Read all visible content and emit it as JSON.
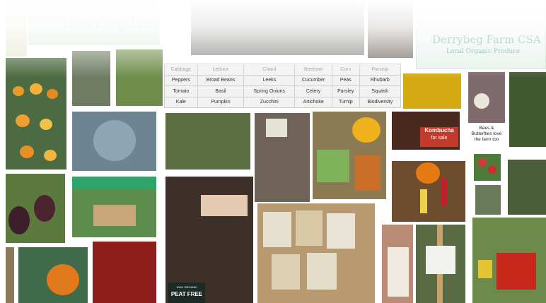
{
  "header_sign": {
    "left_text": "Derrybeg Farm",
    "right_title": "Derrybeg Farm CSA",
    "right_subtitle": "Local Organic Produce"
  },
  "vegetable_table": {
    "rows": [
      [
        "Cabbage",
        "Lettuce",
        "Chard",
        "Beetroot",
        "Corn",
        "Parsnip"
      ],
      [
        "Peppers",
        "Broad Beans",
        "Leeks",
        "Cucumber",
        "Peas",
        "Rhubarb"
      ],
      [
        "Tomato",
        "Basil",
        "Spring Onions",
        "Celery",
        "Parsley",
        "Squash"
      ],
      [
        "Kale",
        "Pumpkin",
        "Zucchini",
        "Artichoke",
        "Turnip",
        "Biodiversity"
      ]
    ]
  },
  "kombucha_sign": {
    "line1": "Kombucha",
    "line2": "for sale"
  },
  "bees_caption": "Bees & Butterflies love the farm too",
  "peat_free_label": {
    "top": "100% ORGANIC",
    "main": "PEAT FREE"
  }
}
